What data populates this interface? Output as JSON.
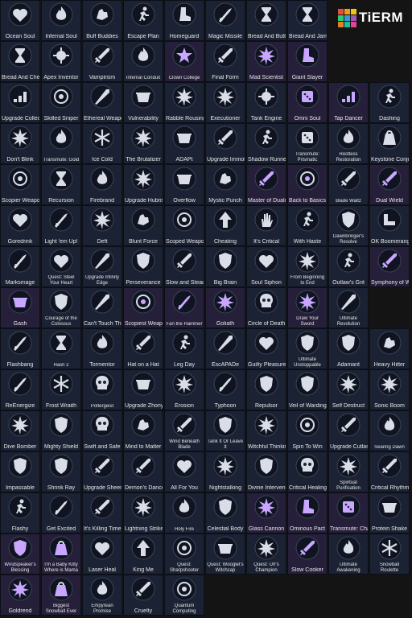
{
  "brand": {
    "wordmark": "TiERM",
    "colors": [
      "#e74c3c",
      "#f39c12",
      "#f1c40f",
      "#2ecc71",
      "#3498db",
      "#9b59b6",
      "#e67e22",
      "#1abc9c",
      "#e84393"
    ]
  },
  "palette": {
    "tile": "#1b2233",
    "tile_purple": "#261f3a",
    "glyph": "#d8dde8",
    "glyph_purple": "#c9a6ff",
    "label": "#e6e6e6"
  },
  "rows": [
    [
      {
        "label": "Ocean Soul",
        "icon": "heart-icon"
      },
      {
        "label": "Infernal Soul",
        "icon": "flame-icon"
      },
      {
        "label": "Buff Buddies",
        "icon": "flex-icon"
      },
      {
        "label": "Escape Plan",
        "icon": "run-icon"
      },
      {
        "label": "Homeguard",
        "icon": "boot-icon"
      },
      {
        "label": "Magic Missile",
        "icon": "missile-icon"
      },
      {
        "label": "Bread And Butter",
        "icon": "hourglass-icon"
      },
      {
        "label": "Bread And Jam",
        "icon": "hourglass-icon"
      }
    ],
    [
      {
        "label": "Bread And Cheese",
        "icon": "hourglass-icon"
      },
      {
        "label": "Apex Inventor",
        "icon": "gear-icon"
      },
      {
        "label": "Vampirism",
        "icon": "sword-icon"
      },
      {
        "label": "Infernal Conduit",
        "icon": "flame-icon",
        "two": true
      },
      {
        "label": "Clown College",
        "icon": "star-icon",
        "purple": true,
        "two": true
      },
      {
        "label": "Final Form",
        "icon": "sword-icon"
      },
      {
        "label": "Mad Scientist",
        "icon": "burst-icon",
        "purple": true
      },
      {
        "label": "Giant Slayer",
        "icon": "boot-icon",
        "purple": true
      }
    ],
    [
      {
        "label": "Upgrade Collector",
        "icon": "chart-icon"
      },
      {
        "label": "Skilled Sniper",
        "icon": "target-icon"
      },
      {
        "label": "Ethereal Weapon",
        "icon": "blade-icon"
      },
      {
        "label": "Vulnerability",
        "icon": "cauldron-icon"
      },
      {
        "label": "Rabble Rousing",
        "icon": "burst-icon"
      },
      {
        "label": "Executioner",
        "icon": "burst-icon"
      },
      {
        "label": "Tank Engine",
        "icon": "gear-icon"
      },
      {
        "label": "Omni Soul",
        "icon": "dice-icon",
        "purple": true
      },
      {
        "label": "Tap Dancer",
        "icon": "chart-icon",
        "purple": true
      },
      {
        "label": "Dashing",
        "icon": "run-icon"
      }
    ],
    [
      {
        "label": "Don't Blink",
        "icon": "burst-icon"
      },
      {
        "label": "Transmute: Gold",
        "icon": "flame-icon",
        "two": true
      },
      {
        "label": "Ice Cold",
        "icon": "snowflake-icon"
      },
      {
        "label": "The Brutalizer",
        "icon": "burst-icon"
      },
      {
        "label": "ADAPt",
        "icon": "cauldron-icon"
      },
      {
        "label": "Upgrade Immolate",
        "icon": "sword-icon"
      },
      {
        "label": "Shadow Runner",
        "icon": "run-icon"
      },
      {
        "label": "Transmute: Prismatic",
        "icon": "dice-icon",
        "two": true
      },
      {
        "label": "Restless Restoration",
        "icon": "flame-icon",
        "two": true
      },
      {
        "label": "Keystone Conjurer",
        "icon": "bag-icon"
      }
    ],
    [
      {
        "label": "Scopier Weapons",
        "icon": "target-icon"
      },
      {
        "label": "Recursion",
        "icon": "hourglass-icon"
      },
      {
        "label": "Firebrand",
        "icon": "flame-icon"
      },
      {
        "label": "Upgrade Hubris",
        "icon": "burst-icon"
      },
      {
        "label": "Overflow",
        "icon": "cauldron-icon"
      },
      {
        "label": "Mystic Punch",
        "icon": "flex-icon"
      },
      {
        "label": "Master of Duality",
        "icon": "sword-icon",
        "purple": true
      },
      {
        "label": "Back to Basics",
        "icon": "target-icon",
        "purple": true
      },
      {
        "label": "Blade Waltz",
        "icon": "sword-icon",
        "two": true
      },
      {
        "label": "Dual Wield",
        "icon": "sword-icon",
        "purple": true
      }
    ],
    [
      {
        "label": "Goredrink",
        "icon": "heart-icon"
      },
      {
        "label": "Light 'em Up!",
        "icon": "missile-icon"
      },
      {
        "label": "Deft",
        "icon": "burst-icon"
      },
      {
        "label": "Blunt Force",
        "icon": "flex-icon"
      },
      {
        "label": "Scoped Weapons",
        "icon": "target-icon"
      },
      {
        "label": "Cheating",
        "icon": "arrow-up-icon"
      },
      {
        "label": "It's Critical",
        "icon": "hand-icon"
      },
      {
        "label": "With Haste",
        "icon": "run-icon"
      },
      {
        "label": "Dawnbringer's Resolve",
        "icon": "shield-icon",
        "two": true
      },
      {
        "label": "OK Boomerang",
        "icon": "boomerang-icon"
      }
    ],
    [
      {
        "label": "Marksmage",
        "icon": "missile-icon"
      },
      {
        "label": "Quest: Steel Your Heart",
        "icon": "heart-icon",
        "two": true
      },
      {
        "label": "Upgrade Infinity Edge",
        "icon": "blade-icon",
        "two": true
      },
      {
        "label": "Perseverance",
        "icon": "shield-icon"
      },
      {
        "label": "Slow and Steady",
        "icon": "sword-icon"
      },
      {
        "label": "Big Brain",
        "icon": "shield-icon"
      },
      {
        "label": "Soul Siphon",
        "icon": "heart-icon"
      },
      {
        "label": "From Beginning to End",
        "icon": "burst-icon",
        "two": true
      },
      {
        "label": "Outlaw's Grit",
        "icon": "run-icon"
      },
      {
        "label": "Symphony of War",
        "icon": "sword-icon",
        "purple": true
      }
    ],
    [
      {
        "label": "Gash",
        "icon": "cauldron-icon",
        "purple": true
      },
      {
        "label": "Courage of the Colossus",
        "icon": "shield-icon",
        "two": true
      },
      {
        "label": "Can't Touch This",
        "icon": "blade-icon"
      },
      {
        "label": "Scopiest Weapons",
        "icon": "target-icon",
        "purple": true
      },
      {
        "label": "Fan the Hammer",
        "icon": "missile-icon",
        "purple": true,
        "two": true
      },
      {
        "label": "Goliath",
        "icon": "burst-icon",
        "purple": true
      },
      {
        "label": "Circle of Death",
        "icon": "skull-icon"
      },
      {
        "label": "Draw Your Sword",
        "icon": "burst-icon",
        "purple": true,
        "two": true
      },
      {
        "label": "Ultimate Revolution",
        "icon": "blade-icon",
        "two": true
      }
    ],
    [
      {
        "label": "Flashbang",
        "icon": "missile-icon"
      },
      {
        "label": "Hash 2",
        "icon": "hourglass-icon",
        "two": true
      },
      {
        "label": "Tormentor",
        "icon": "flame-icon"
      },
      {
        "label": "Hat on a Hat",
        "icon": "sword-icon"
      },
      {
        "label": "Leg Day",
        "icon": "run-icon"
      },
      {
        "label": "EscAPADe",
        "icon": "blade-icon"
      },
      {
        "label": "Guilty Pleasure",
        "icon": "heart-icon"
      },
      {
        "label": "Ultimate Unstoppable",
        "icon": "shield-icon",
        "two": true
      },
      {
        "label": "Adamant",
        "icon": "shield-icon"
      },
      {
        "label": "Heavy Hitter",
        "icon": "flex-icon"
      }
    ],
    [
      {
        "label": "ReEnergize",
        "icon": "missile-icon"
      },
      {
        "label": "Frost Wraith",
        "icon": "snowflake-icon"
      },
      {
        "label": "Poltergeist",
        "icon": "skull-icon",
        "two": true
      },
      {
        "label": "Upgrade Zhonya's",
        "icon": "cauldron-icon"
      },
      {
        "label": "Erosion",
        "icon": "burst-icon"
      },
      {
        "label": "Typhoon",
        "icon": "missile-icon"
      },
      {
        "label": "Repulsor",
        "icon": "shield-icon"
      },
      {
        "label": "Veil of Warding",
        "icon": "shield-icon"
      },
      {
        "label": "Self Destruct",
        "icon": "burst-icon"
      },
      {
        "label": "Sonic Boom",
        "icon": "burst-icon"
      }
    ],
    [
      {
        "label": "Dive Bomber",
        "icon": "burst-icon"
      },
      {
        "label": "Mighty Shield",
        "icon": "shield-icon"
      },
      {
        "label": "Swift and Safe",
        "icon": "skull-icon"
      },
      {
        "label": "Mind to Matter",
        "icon": "flex-icon"
      },
      {
        "label": "Wind Beneath Blade",
        "icon": "sword-icon",
        "two": true
      },
      {
        "label": "Tank It Or Leave It",
        "icon": "shield-icon",
        "two": true
      },
      {
        "label": "Witchful Thinking",
        "icon": "burst-icon"
      },
      {
        "label": "Spin To Win",
        "icon": "target-icon"
      },
      {
        "label": "Upgrade Cutlass",
        "icon": "sword-icon"
      },
      {
        "label": "Searing Dawn",
        "icon": "flame-icon",
        "two": true
      }
    ],
    [
      {
        "label": "Impassable",
        "icon": "shield-icon"
      },
      {
        "label": "Shrink Ray",
        "icon": "shield-icon"
      },
      {
        "label": "Upgrade Sheen",
        "icon": "sword-icon"
      },
      {
        "label": "Demon's Dance",
        "icon": "sword-icon"
      },
      {
        "label": "All For You",
        "icon": "heart-icon"
      },
      {
        "label": "Nightstalking",
        "icon": "burst-icon"
      },
      {
        "label": "Divine Intervention",
        "icon": "shield-icon"
      },
      {
        "label": "Critical Healing",
        "icon": "skull-icon"
      },
      {
        "label": "Spiritual Purification",
        "icon": "burst-icon",
        "two": true
      },
      {
        "label": "Critical Rhythm",
        "icon": "sword-icon"
      }
    ],
    [
      {
        "label": "Flashy",
        "icon": "run-icon"
      },
      {
        "label": "Get Excited",
        "icon": "missile-icon"
      },
      {
        "label": "It's Killing Time",
        "icon": "sword-icon"
      },
      {
        "label": "Lightning Strikes",
        "icon": "burst-icon"
      },
      {
        "label": "Holy Fire",
        "icon": "flame-icon",
        "two": true
      },
      {
        "label": "Celestial Body",
        "icon": "shield-icon"
      },
      {
        "label": "Glass Cannon",
        "icon": "burst-icon",
        "purple": true
      },
      {
        "label": "Ominous Pact",
        "icon": "boot-icon",
        "purple": true
      },
      {
        "label": "Transmute: Chaos",
        "icon": "dice-icon",
        "purple": true
      },
      {
        "label": "Protein Shake",
        "icon": "cauldron-icon"
      }
    ],
    [
      {
        "label": "Windspeaker's Blessing",
        "icon": "shield-icon",
        "purple": true,
        "two": true
      },
      {
        "label": "I'm a Baby Kitty Where is Mama",
        "icon": "bag-icon",
        "purple": true,
        "two": true
      },
      {
        "label": "Laser Heal",
        "icon": "heart-icon"
      },
      {
        "label": "King Me",
        "icon": "arrow-up-icon"
      },
      {
        "label": "Quest: Sharpshooter",
        "icon": "target-icon",
        "two": true
      },
      {
        "label": "Quest: Wooglet's Witchcap",
        "icon": "cauldron-icon",
        "two": true
      },
      {
        "label": "Quest: Urf's Champion",
        "icon": "burst-icon",
        "two": true
      },
      {
        "label": "Slow Cooker",
        "icon": "sword-icon",
        "purple": true
      },
      {
        "label": "Ultimate Awakening",
        "icon": "flame-icon",
        "two": true
      },
      {
        "label": "Snowball Roulette",
        "icon": "snowflake-icon",
        "two": true
      }
    ],
    [
      {
        "label": "Goldrend",
        "icon": "burst-icon",
        "purple": true
      },
      {
        "label": "Biggest Snowball Ever",
        "icon": "bag-icon",
        "purple": true,
        "two": true
      },
      {
        "label": "Empyrean Promise",
        "icon": "flame-icon",
        "two": true
      },
      {
        "label": "Cruelty",
        "icon": "sword-icon"
      },
      {
        "label": "Quantum Computing",
        "icon": "target-icon",
        "two": true
      }
    ]
  ]
}
